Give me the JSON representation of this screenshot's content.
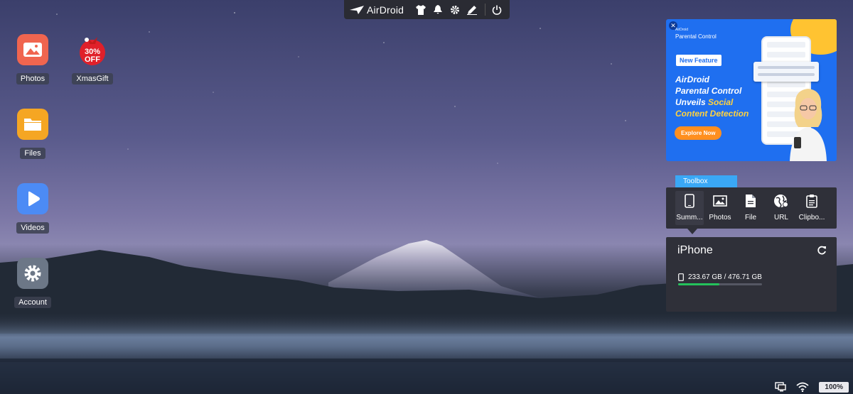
{
  "topbar": {
    "logo_text": "AirDroid",
    "icons": [
      "tshirt-icon",
      "bell-icon",
      "gear-icon",
      "pen-icon",
      "power-icon"
    ]
  },
  "desktop": {
    "icons": [
      {
        "label": "Photos",
        "icon": "photos-icon",
        "color": "#f0654f"
      },
      {
        "label": "XmasGift",
        "icon": "gift-badge-icon",
        "color": "#e0202a",
        "badge_line1": "30%",
        "badge_line2": "OFF"
      },
      {
        "label": "Files",
        "icon": "folder-icon",
        "color": "#f5a623"
      },
      {
        "label": "Videos",
        "icon": "play-icon",
        "color": "#4c8bf5"
      },
      {
        "label": "Account",
        "icon": "gear-icon",
        "color": "#6c7787"
      }
    ]
  },
  "ad": {
    "brand_small": "AirDroid",
    "brand": "Parental Control",
    "badge": "New Feature",
    "headline_1": "AirDroid",
    "headline_2": "Parental Control",
    "headline_3a": "Unveils ",
    "headline_3b": "Social",
    "headline_4": "Content Detection",
    "cta": "Explore Now",
    "colors": {
      "background": "#1f6ff0",
      "highlight": "#ffd23f",
      "cta": "#ff8f1f"
    }
  },
  "toolbox": {
    "tab_label": "Toolbox",
    "tools": [
      {
        "label": "Summ...",
        "icon": "phone-icon",
        "active": true
      },
      {
        "label": "Photos",
        "icon": "image-icon",
        "active": false
      },
      {
        "label": "File",
        "icon": "file-icon",
        "active": false
      },
      {
        "label": "URL",
        "icon": "globe-icon",
        "active": false
      },
      {
        "label": "Clipbo...",
        "icon": "clipboard-icon",
        "active": false
      }
    ]
  },
  "device": {
    "name": "iPhone",
    "storage_text": "233.67 GB / 476.71 GB",
    "storage_used_fraction": 0.49,
    "bar_color": "#24c25b"
  },
  "tray": {
    "icons": [
      "screen-icon",
      "wifi-icon"
    ],
    "zoom": "100%"
  }
}
